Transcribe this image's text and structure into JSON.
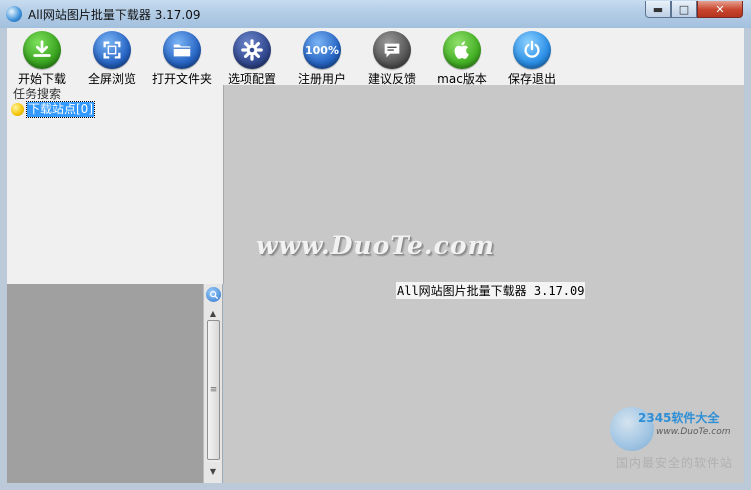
{
  "window": {
    "title": "All网站图片批量下载器 3.17.09",
    "controls": {
      "minimize": "▬",
      "maximize": "□",
      "close": "✕"
    }
  },
  "toolbar": {
    "items": [
      {
        "label": "开始下载",
        "icon": "download-icon",
        "color": "#3aa320"
      },
      {
        "label": "全屏浏览",
        "icon": "fullscreen-icon",
        "color": "#2765c4"
      },
      {
        "label": "打开文件夹",
        "icon": "folder-icon",
        "color": "#2765c4"
      },
      {
        "label": "选项配置",
        "icon": "gear-icon",
        "color": "#32498f"
      },
      {
        "label": "注册用户",
        "icon": "badge-100-icon",
        "badge_text": "100%",
        "color": "#2765c4"
      },
      {
        "label": "建议反馈",
        "icon": "chat-bubble-icon",
        "color": "#555555"
      },
      {
        "label": "mac版本",
        "icon": "apple-icon",
        "color": "#44b025"
      },
      {
        "label": "保存退出",
        "icon": "power-icon",
        "color": "#2b8fe6"
      }
    ]
  },
  "left_panel": {
    "header": "任务搜索",
    "tree": [
      {
        "label": "下载站点[0]",
        "icon": "folder-dot-icon",
        "selected": true
      }
    ]
  },
  "scrollbar": {
    "up": "▲",
    "down": "▼",
    "grip": "≡"
  },
  "main": {
    "watermark": "www.DuoTe.com",
    "center_text": "All网站图片批量下载器 3.17.09"
  },
  "corner_logo": {
    "brand": "2345软件大全",
    "url": "www.DuoTe.com",
    "slogan": "国内最安全的软件站"
  }
}
